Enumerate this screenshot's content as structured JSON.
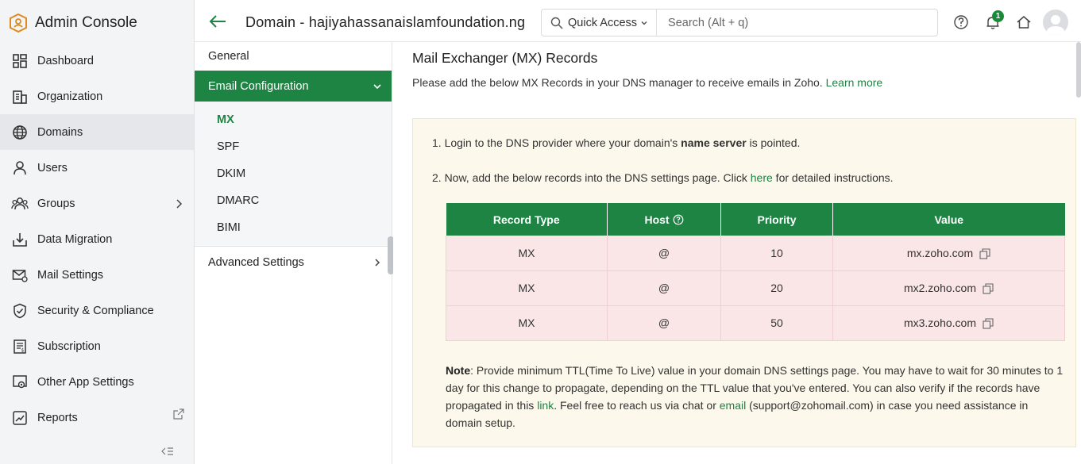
{
  "sidebar": {
    "title": "Admin Console",
    "items": [
      {
        "label": "Dashboard",
        "icon": "dashboard-icon"
      },
      {
        "label": "Organization",
        "icon": "organization-icon"
      },
      {
        "label": "Domains",
        "icon": "globe-icon",
        "active": true
      },
      {
        "label": "Users",
        "icon": "user-icon"
      },
      {
        "label": "Groups",
        "icon": "groups-icon"
      },
      {
        "label": "Data Migration",
        "icon": "data-migration-icon"
      },
      {
        "label": "Mail Settings",
        "icon": "mail-settings-icon"
      },
      {
        "label": "Security & Compliance",
        "icon": "shield-check-icon"
      },
      {
        "label": "Subscription",
        "icon": "subscription-icon"
      },
      {
        "label": "Other App Settings",
        "icon": "app-settings-icon"
      },
      {
        "label": "Reports",
        "icon": "reports-icon"
      }
    ]
  },
  "header": {
    "title": "Domain - hajiyahassanaislamfoundation.ng",
    "quick_access": "Quick Access",
    "search_placeholder": "Search (Alt + q)",
    "notification_count": "1"
  },
  "subnav": {
    "general": "General",
    "email_config": "Email Configuration",
    "children": [
      "MX",
      "SPF",
      "DKIM",
      "DMARC",
      "BIMI"
    ],
    "active_child": "MX",
    "advanced": "Advanced Settings"
  },
  "main": {
    "heading": "Mail Exchanger (MX) Records",
    "description": "Please add the below MX Records in your DNS manager to receive emails in Zoho.",
    "learn_more": "Learn more",
    "step1_pre": "1. Login to the DNS provider where your domain's ",
    "step1_bold": "name server",
    "step1_post": " is pointed.",
    "step2_pre": "2. Now, add the below records into the DNS settings page. Click ",
    "step2_link": "here",
    "step2_post": " for detailed instructions.",
    "table": {
      "headers": [
        "Record Type",
        "Host",
        "Priority",
        "Value"
      ],
      "rows": [
        [
          "MX",
          "@",
          "10",
          "mx.zoho.com"
        ],
        [
          "MX",
          "@",
          "20",
          "mx2.zoho.com"
        ],
        [
          "MX",
          "@",
          "50",
          "mx3.zoho.com"
        ]
      ]
    },
    "note_label": "Note",
    "note_p1": ": Provide minimum TTL(Time To Live) value in your domain DNS settings page. You may have to wait for 30 minutes to 1 day for this change to propagate, depending on the TTL value that you've entered. You can also verify if the records have propagated in this ",
    "note_link1": "link",
    "note_p2": ". Feel free to reach us via chat or ",
    "note_link2": "email",
    "note_p3": " (support@zohomail.com) in case you need assistance in domain setup."
  },
  "colors": {
    "accent": "#1e8444",
    "table_row": "#fae6e6",
    "info_bg": "#fdf8ec"
  }
}
